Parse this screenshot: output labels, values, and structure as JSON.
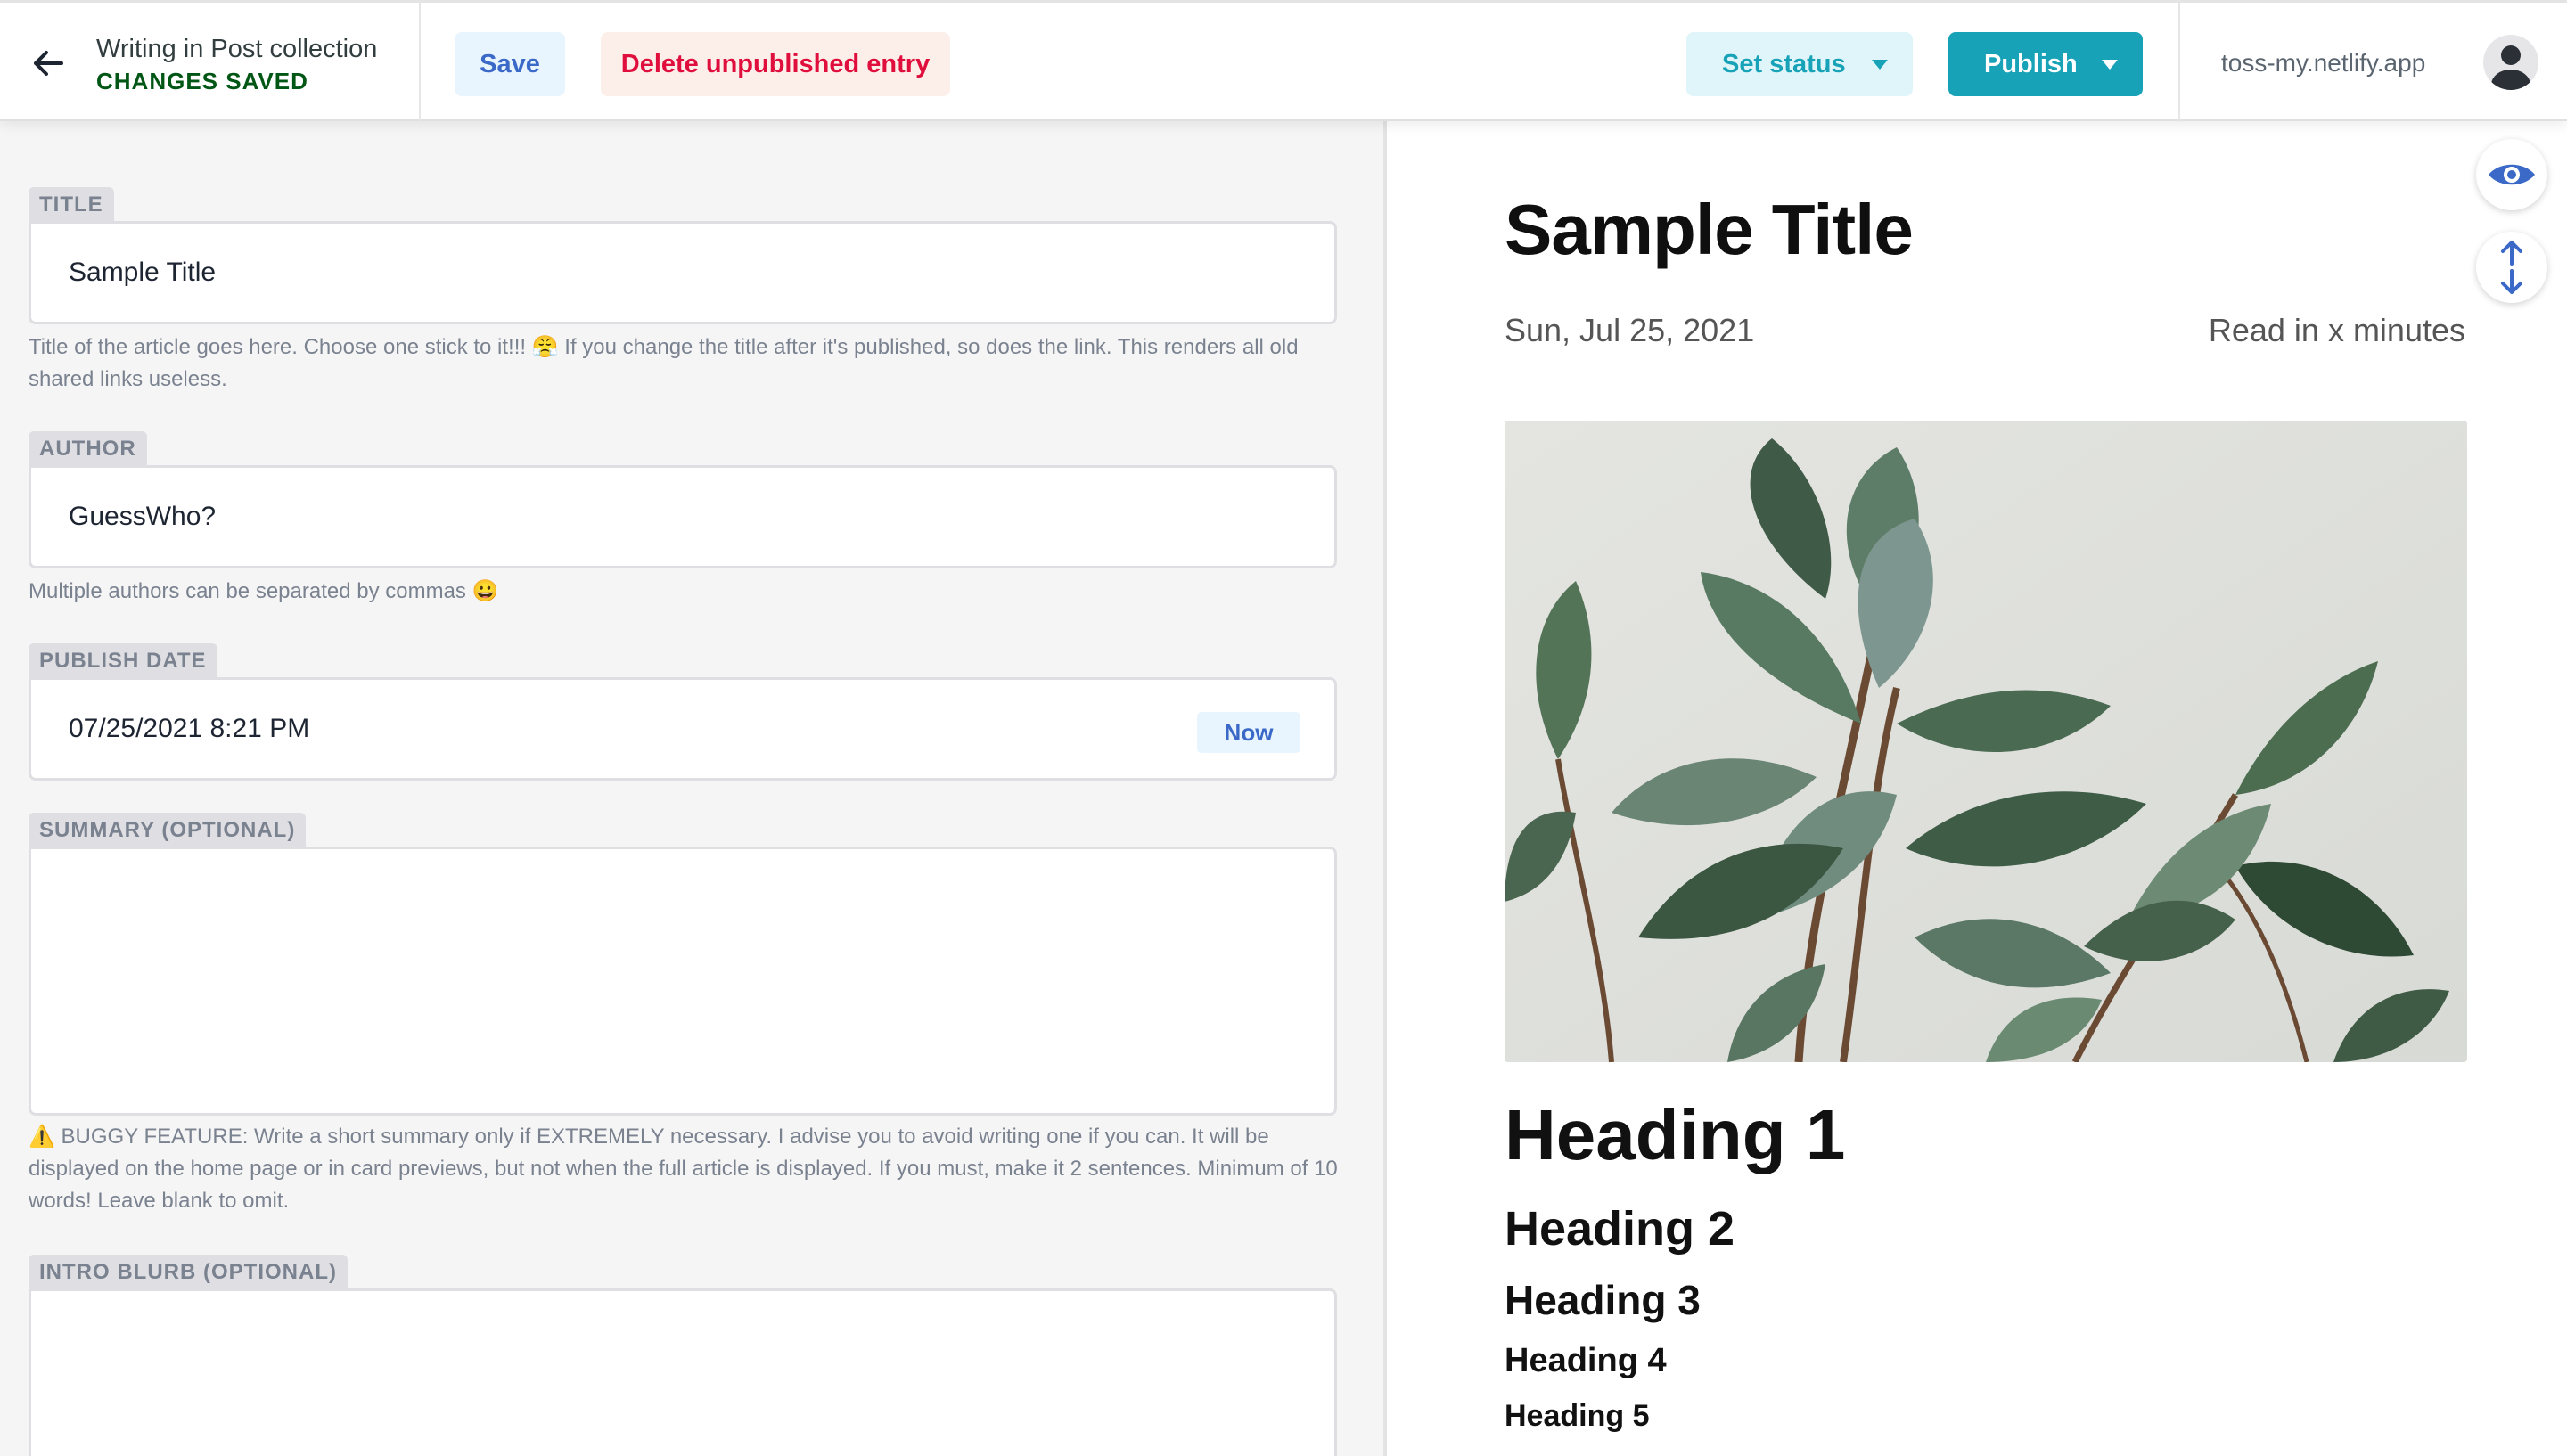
{
  "header": {
    "breadcrumb": "Writing in Post collection",
    "save_status": "CHANGES SAVED",
    "save_label": "Save",
    "delete_label": "Delete unpublished entry",
    "set_status_label": "Set status",
    "publish_label": "Publish",
    "site_url": "toss-my.netlify.app"
  },
  "fields": {
    "title": {
      "label": "TITLE",
      "value": "Sample Title",
      "hint": "Title of the article goes here. Choose one stick to it!!! 😤 If you change the title after it's published, so does the link. This renders all old shared links useless."
    },
    "author": {
      "label": "AUTHOR",
      "value": "GuessWho?",
      "hint": "Multiple authors can be separated by commas 😀"
    },
    "publish_date": {
      "label": "PUBLISH DATE",
      "value": "07/25/2021 8:21 PM",
      "now_label": "Now"
    },
    "summary": {
      "label": "SUMMARY (OPTIONAL)",
      "value": "",
      "hint": "⚠️ BUGGY FEATURE: Write a short summary only if EXTREMELY necessary. I advise you to avoid writing one if you can. It will be displayed on the home page or in card previews, but not when the full article is displayed. If you must, make it 2 sentences. Minimum of 10 words! Leave blank to omit."
    },
    "intro_blurb": {
      "label": "INTRO BLURB (OPTIONAL)",
      "value": ""
    }
  },
  "preview": {
    "title": "Sample Title",
    "date": "Sun, Jul 25, 2021",
    "read_time": "Read in x minutes",
    "headings": [
      "Heading 1",
      "Heading 2",
      "Heading 3",
      "Heading 4",
      "Heading 5"
    ]
  },
  "icons": {
    "back": "arrow-left-icon",
    "avatar": "user-avatar-icon",
    "preview_toggle": "eye-icon",
    "sync_scroll": "sync-scroll-icon"
  },
  "colors": {
    "accent": "#17a2b8",
    "save_text": "#3a69c7",
    "delete_text": "#e00e3c",
    "saved_text": "#005614"
  }
}
